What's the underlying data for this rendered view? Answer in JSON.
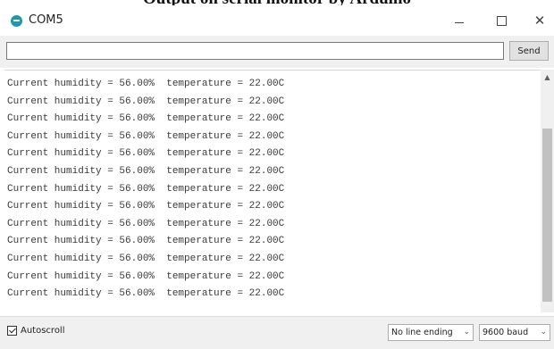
{
  "caption": "Output on serial monitor by Arduino",
  "window": {
    "title": "COM5",
    "controls": {
      "minimize": "–",
      "maximize": "☐",
      "close": "✕"
    }
  },
  "send_row": {
    "input_value": "",
    "send_label": "Send"
  },
  "output": {
    "lines": [
      "Current humidity = 56.00%  temperature = 22.00C",
      "Current humidity = 56.00%  temperature = 22.00C",
      "Current humidity = 56.00%  temperature = 22.00C",
      "Current humidity = 56.00%  temperature = 22.00C",
      "Current humidity = 56.00%  temperature = 22.00C",
      "Current humidity = 56.00%  temperature = 22.00C",
      "Current humidity = 56.00%  temperature = 22.00C",
      "Current humidity = 56.00%  temperature = 22.00C",
      "Current humidity = 56.00%  temperature = 22.00C",
      "Current humidity = 56.00%  temperature = 22.00C",
      "Current humidity = 56.00%  temperature = 22.00C",
      "Current humidity = 56.00%  temperature = 22.00C",
      "Current humidity = 56.00%  temperature = 22.00C"
    ]
  },
  "bottom_bar": {
    "autoscroll_label": "Autoscroll",
    "autoscroll_checked": true,
    "line_ending_value": "No line ending",
    "baud_value": "9600 baud"
  },
  "icons": {
    "app": "arduino-icon",
    "scroll_up": "scroll-up-arrow-icon",
    "dropdown": "chevron-down-icon"
  }
}
